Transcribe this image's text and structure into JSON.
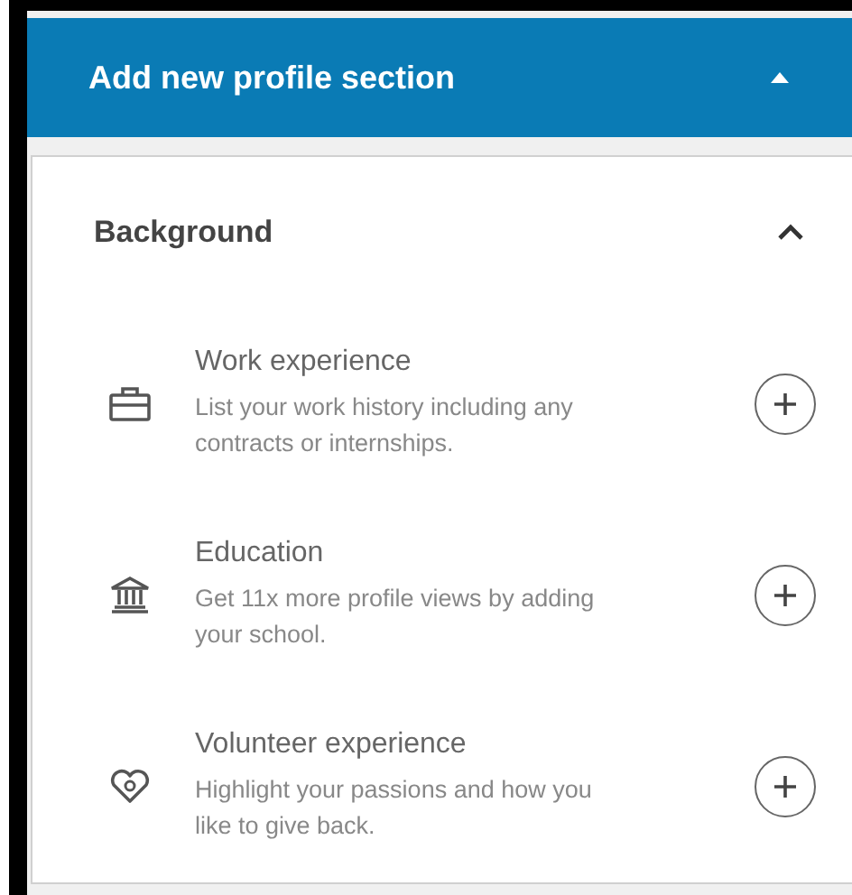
{
  "header": {
    "title": "Add new profile section",
    "expanded": true
  },
  "section": {
    "title": "Background",
    "expanded": true,
    "items": [
      {
        "kind": "work",
        "title": "Work experience",
        "description": "List your work history including any contracts or internships."
      },
      {
        "kind": "education",
        "title": "Education",
        "description": "Get 11x more profile views by adding your school."
      },
      {
        "kind": "volunteer",
        "title": "Volunteer experience",
        "description": "Highlight your passions and how you like to give back."
      }
    ]
  }
}
